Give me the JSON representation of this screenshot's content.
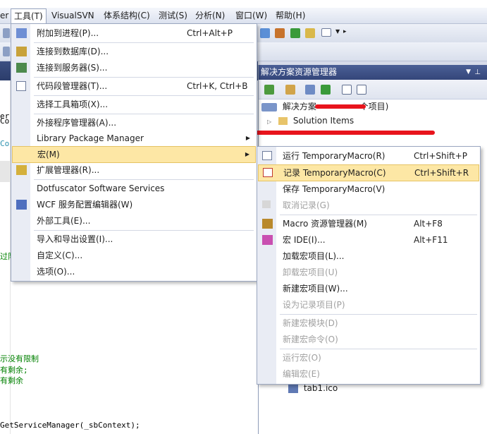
{
  "menubar": {
    "items": [
      "er",
      "工具(T)",
      "VisualSVN",
      "体系结构(C)",
      "测试(S)",
      "分析(N)",
      "窗口(W)",
      "帮助(H)"
    ]
  },
  "tools_menu": {
    "items": [
      {
        "label": "附加到进程(P)...",
        "shortcut": "Ctrl+Alt+P"
      },
      {
        "label": "连接到数据库(D)...",
        "shortcut": ""
      },
      {
        "label": "连接到服务器(S)...",
        "shortcut": ""
      },
      {
        "label": "代码段管理器(T)...",
        "shortcut": "Ctrl+K, Ctrl+B"
      },
      {
        "label": "选择工具箱项(X)...",
        "shortcut": ""
      },
      {
        "label": "外接程序管理器(A)...",
        "shortcut": ""
      },
      {
        "label": "Library Package Manager",
        "shortcut": ""
      },
      {
        "label": "宏(M)",
        "shortcut": ""
      },
      {
        "label": "扩展管理器(R)...",
        "shortcut": ""
      },
      {
        "label": "Dotfuscator Software Services",
        "shortcut": ""
      },
      {
        "label": "WCF 服务配置编辑器(W)",
        "shortcut": ""
      },
      {
        "label": "外部工具(E)...",
        "shortcut": ""
      },
      {
        "label": "导入和导出设置(I)...",
        "shortcut": ""
      },
      {
        "label": "自定义(C)...",
        "shortcut": ""
      },
      {
        "label": "选项(O)...",
        "shortcut": ""
      }
    ]
  },
  "macro_menu": {
    "items": [
      {
        "label": "运行 TemporaryMacro(R)",
        "shortcut": "Ctrl+Shift+P"
      },
      {
        "label": "记录 TemporaryMacro(C)",
        "shortcut": "Ctrl+Shift+R"
      },
      {
        "label": "保存 TemporaryMacro(V)",
        "shortcut": ""
      },
      {
        "label": "取消记录(G)",
        "shortcut": ""
      },
      {
        "label": "Macro 资源管理器(M)",
        "shortcut": "Alt+F8"
      },
      {
        "label": "宏 IDE(I)...",
        "shortcut": "Alt+F11"
      },
      {
        "label": "加载宏项目(L)...",
        "shortcut": ""
      },
      {
        "label": "卸载宏项目(U)",
        "shortcut": ""
      },
      {
        "label": "新建宏项目(W)...",
        "shortcut": ""
      },
      {
        "label": "设为记录项目(P)",
        "shortcut": ""
      },
      {
        "label": "新建宏模块(D)",
        "shortcut": ""
      },
      {
        "label": "新建宏命令(O)",
        "shortcut": ""
      },
      {
        "label": "运行宏(O)",
        "shortcut": ""
      },
      {
        "label": "编辑宏(E)",
        "shortcut": ""
      }
    ]
  },
  "solution_explorer": {
    "title": "解决方案资源管理器",
    "solution_label": "解决方案",
    "solution_suffix": "个项目)",
    "solution_items": "Solution Items",
    "file": "tab1.ico"
  },
  "editor": {
    "code_fragments": [
      "Co",
      "Co",
      "过队",
      "示没有限制",
      "有剩余;",
      "有剩余",
      "GetServiceManager(_sbContext);",
      "er"
    ]
  }
}
